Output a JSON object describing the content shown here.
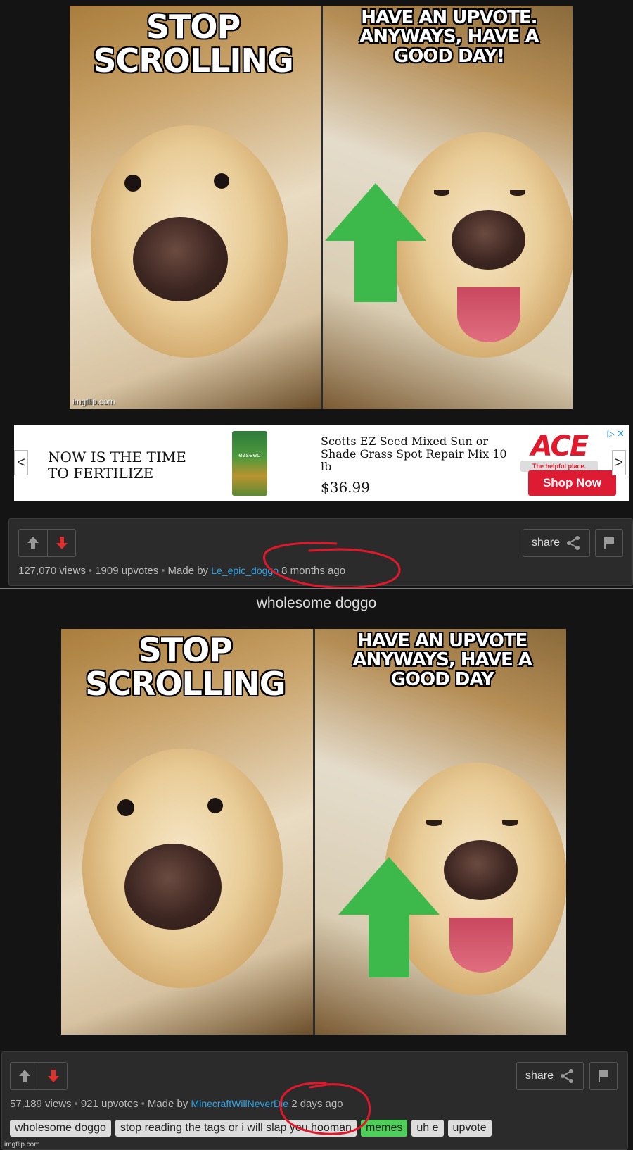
{
  "post1": {
    "caption_left": "STOP SCROLLING",
    "caption_right": "HAVE AN UPVOTE. ANYWAYS, HAVE A GOOD DAY!",
    "watermark": "imgflip.com",
    "share_label": "share",
    "views": "127,070 views",
    "upvotes": "1909 upvotes",
    "made_by": "Made by",
    "author": "Le_epic_doggo",
    "time_ago": "8 months ago"
  },
  "ad": {
    "headline": "NOW IS THE TIME TO FERTILIZE",
    "product_name": "Scotts EZ Seed Mixed Sun or Shade Grass Spot Repair Mix 10 lb",
    "product_pack_text": "ezseed",
    "price": "$36.99",
    "brand": "ACE",
    "brand_tagline": "The helpful place.",
    "cta": "Shop Now",
    "nav_prev": "<",
    "nav_next": ">"
  },
  "post2": {
    "title": "wholesome doggo",
    "caption_left": "STOP SCROLLING",
    "caption_right": "HAVE AN UPVOTE ANYWAYS, HAVE A GOOD DAY",
    "share_label": "share",
    "views": "57,189 views",
    "upvotes": "921 upvotes",
    "made_by": "Made by",
    "author": "MinecraftWillNeverDie",
    "time_ago": "2 days ago",
    "tags": [
      "wholesome doggo",
      "stop reading the tags or i will slap you hooman",
      "memes",
      "uh e",
      "upvote"
    ]
  },
  "footer_watermark": "imgflip.com",
  "colors": {
    "background": "#141414",
    "bar": "#2b2b2b",
    "author_link": "#2fa4e7",
    "downvote": "#e02f2f",
    "upvote_arrow": "#3cb94a",
    "annotation_red": "#e0182c",
    "tag_highlight": "#4ecf5a"
  }
}
